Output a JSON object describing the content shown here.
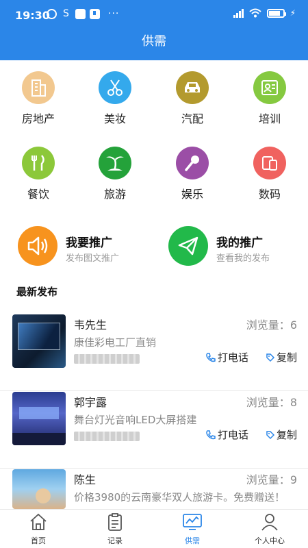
{
  "statusbar": {
    "time": "19:30",
    "dots": "···",
    "icons": [
      "alarm-icon",
      "s-icon",
      "app-icon",
      "download-icon",
      "signal-icon",
      "wifi-icon",
      "battery-icon",
      "charging-icon"
    ]
  },
  "header": {
    "title": "供需"
  },
  "categories": [
    {
      "label": "房地产",
      "icon": "building-icon",
      "color": "#f2c88f"
    },
    {
      "label": "美妆",
      "icon": "scissors-icon",
      "color": "#34a9ec"
    },
    {
      "label": "汽配",
      "icon": "car-icon",
      "color": "#b39a2e"
    },
    {
      "label": "培训",
      "icon": "certificate-icon",
      "color": "#85c940"
    },
    {
      "label": "餐饮",
      "icon": "fork-knife-icon",
      "color": "#8cc83a"
    },
    {
      "label": "旅游",
      "icon": "palm-tree-icon",
      "color": "#24a23a"
    },
    {
      "label": "娱乐",
      "icon": "microphone-icon",
      "color": "#9b4ea6"
    },
    {
      "label": "数码",
      "icon": "devices-icon",
      "color": "#f0625f"
    }
  ],
  "promo": {
    "left": {
      "title": "我要推广",
      "subtitle": "发布图文推广",
      "color": "#f7931e"
    },
    "right": {
      "title": "我的推广",
      "subtitle": "查看我的发布",
      "color": "#22b94a"
    }
  },
  "latest": {
    "title": "最新发布",
    "views_label": "浏览量：",
    "call_label": "打电话",
    "copy_label": "复制",
    "items": [
      {
        "name": "韦先生",
        "views": "6",
        "desc": "康佳彩电工厂直销"
      },
      {
        "name": "郭宇露",
        "views": "8",
        "desc": "舞台灯光音响LED大屏搭建"
      },
      {
        "name": "陈生",
        "views": "9",
        "desc": "价格3980的云南豪华双人旅游卡。免费赠送！"
      }
    ]
  },
  "tabs": [
    {
      "label": "首页",
      "icon": "home-icon"
    },
    {
      "label": "记录",
      "icon": "clipboard-icon"
    },
    {
      "label": "供需",
      "icon": "chart-monitor-icon",
      "active": true
    },
    {
      "label": "个人中心",
      "icon": "user-icon"
    }
  ],
  "colors": {
    "primary": "#2b86e8"
  }
}
